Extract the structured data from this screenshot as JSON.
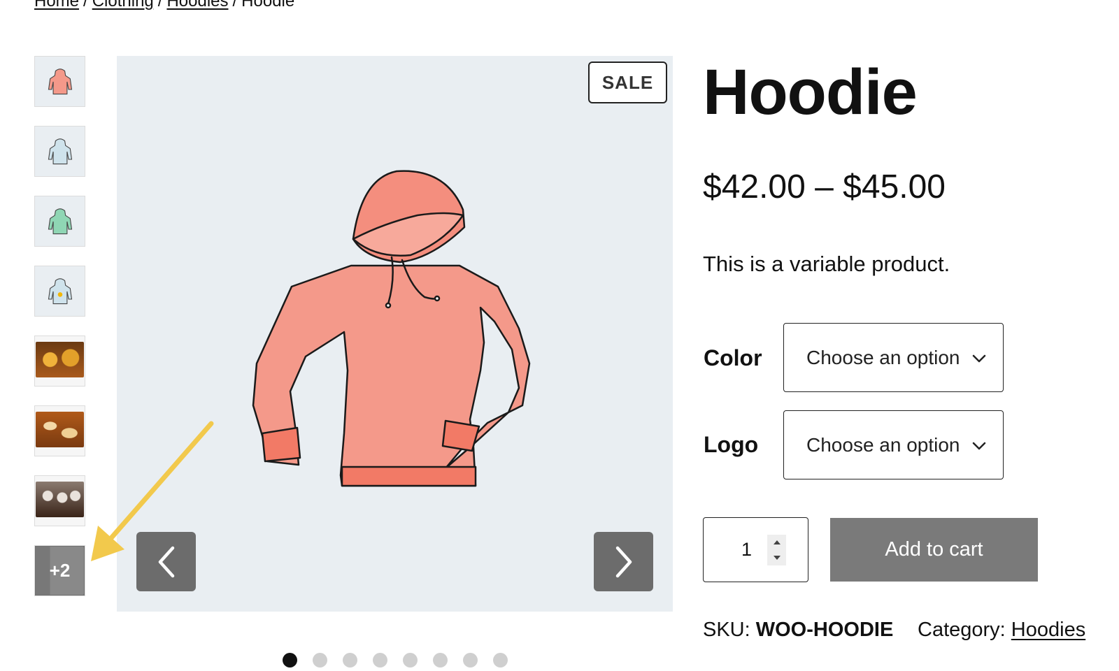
{
  "breadcrumb": {
    "items": [
      "Home",
      "Clothing",
      "Hoodies"
    ],
    "current": "Hoodie",
    "separator": "/"
  },
  "gallery": {
    "thumbnails": [
      {
        "subject": "hoodie-red"
      },
      {
        "subject": "hoodie-blue"
      },
      {
        "subject": "hoodie-green"
      },
      {
        "subject": "hoodie-with-logo"
      },
      {
        "subject": "pastry-photo"
      },
      {
        "subject": "bread-photo"
      },
      {
        "subject": "cupcakes-photo"
      },
      {
        "subject": "room-photo",
        "more_label": "+2"
      }
    ],
    "sale_badge": "SALE",
    "prev_icon": "chevron-left-icon",
    "next_icon": "chevron-right-icon",
    "slide_count": 8,
    "active_slide": 1
  },
  "product": {
    "title": "Hoodie",
    "price": "$42.00 – $45.00",
    "short_description": "This is a variable product.",
    "attributes": [
      {
        "label": "Color",
        "placeholder": "Choose an option"
      },
      {
        "label": "Logo",
        "placeholder": "Choose an option"
      }
    ],
    "quantity": "1",
    "add_to_cart_label": "Add to cart",
    "sku_label": "SKU:",
    "sku_value": "WOO-HOODIE",
    "category_label": "Category:",
    "category_value": "Hoodies"
  },
  "annotation": {
    "color": "#f2c94c"
  },
  "colors": {
    "hoodie": "#f4998a",
    "nav_button": "#6c6c6c",
    "add_to_cart": "#7a7a7a",
    "image_bg": "#e9eef2"
  }
}
